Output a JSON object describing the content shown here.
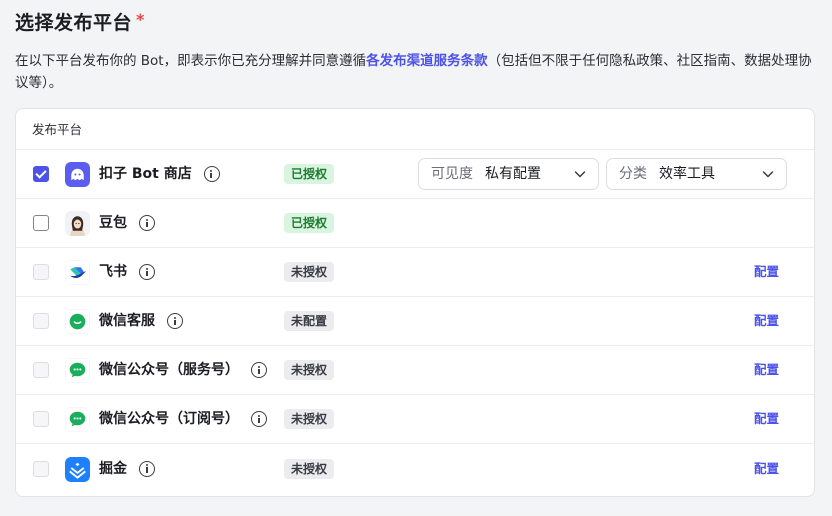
{
  "header": {
    "title": "选择发布平台",
    "required_mark": "*",
    "desc_before": "在以下平台发布你的 Bot，即表示你已充分理解并同意遵循",
    "desc_link": "各发布渠道服务条款",
    "desc_after": "（包括但不限于任何隐私政策、社区指南、数据处理协议等）。"
  },
  "table": {
    "header": "发布平台",
    "rows": [
      {
        "name": "扣子 Bot 商店",
        "status": "已授权",
        "status_type": "authorized",
        "checked": true,
        "enabled": true,
        "logo": "coze-store-logo"
      },
      {
        "name": "豆包",
        "status": "已授权",
        "status_type": "authorized",
        "checked": false,
        "enabled": true,
        "logo": "doubao-logo"
      },
      {
        "name": "飞书",
        "status": "未授权",
        "status_type": "unauthorized",
        "checked": false,
        "enabled": false,
        "action": "配置",
        "logo": "feishu-logo"
      },
      {
        "name": "微信客服",
        "status": "未配置",
        "status_type": "unconfigured",
        "checked": false,
        "enabled": false,
        "action": "配置",
        "logo": "wechat-logo"
      },
      {
        "name": "微信公众号（服务号）",
        "status": "未授权",
        "status_type": "unauthorized",
        "checked": false,
        "enabled": false,
        "action": "配置",
        "logo": "wechat-logo"
      },
      {
        "name": "微信公众号（订阅号）",
        "status": "未授权",
        "status_type": "unauthorized",
        "checked": false,
        "enabled": false,
        "action": "配置",
        "logo": "wechat-logo"
      },
      {
        "name": "掘金",
        "status": "未授权",
        "status_type": "unauthorized",
        "checked": false,
        "enabled": false,
        "action": "配置",
        "logo": "juejin-logo"
      }
    ],
    "visibility": {
      "label": "可见度",
      "value": "私有配置"
    },
    "category": {
      "label": "分类",
      "value": "效率工具"
    }
  },
  "colors": {
    "accent": "#4d53e8",
    "authorized_bg": "#d9f5df",
    "authorized_text": "#1f7a33",
    "neutral_bg": "#ececef",
    "required": "#ef4444"
  }
}
